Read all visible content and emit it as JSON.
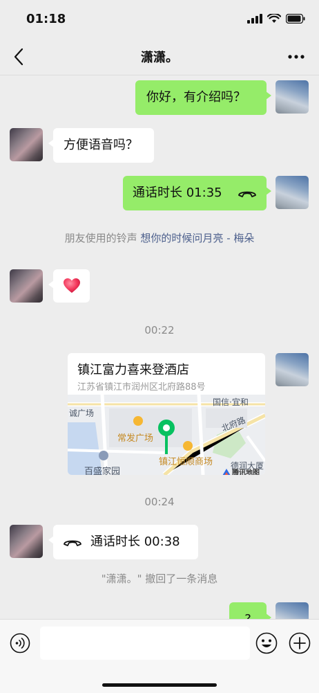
{
  "status_bar": {
    "time": "01:18"
  },
  "header": {
    "title": "潇潇。"
  },
  "messages": [
    {
      "id": "m1",
      "text": "你好，有介绍吗？"
    },
    {
      "id": "m2",
      "text": "方便语音吗？"
    },
    {
      "id": "m3",
      "label": "通话时长 01:35"
    },
    {
      "id": "m4",
      "prefix": "朋友使用的铃声",
      "song": "想你的时候问月亮 - 梅朵"
    },
    {
      "id": "m5",
      "emoji": "heart"
    },
    {
      "id": "m6",
      "time": "00:22"
    },
    {
      "id": "m7",
      "name": "镇江富力喜来登酒店",
      "address": "江苏省镇江市润州区北府路88号",
      "map_labels": [
        "国信·宜和",
        "诚广场",
        "北府路",
        "常发广场",
        "镇江恒顺商场",
        "百盛家园",
        "德润大厦",
        "腾讯地图"
      ]
    },
    {
      "id": "m8",
      "time": "00:24"
    },
    {
      "id": "m9",
      "label": "通话时长 00:38"
    },
    {
      "id": "m10",
      "text": "\"潇潇。\" 撤回了一条消息"
    },
    {
      "id": "m11",
      "text": "?"
    }
  ],
  "input_bar": {
    "placeholder": ""
  },
  "colors": {
    "bubble_green": "#95ec69",
    "background": "#ededed",
    "link": "#4c5f8c",
    "map_pin": "#07c160"
  }
}
